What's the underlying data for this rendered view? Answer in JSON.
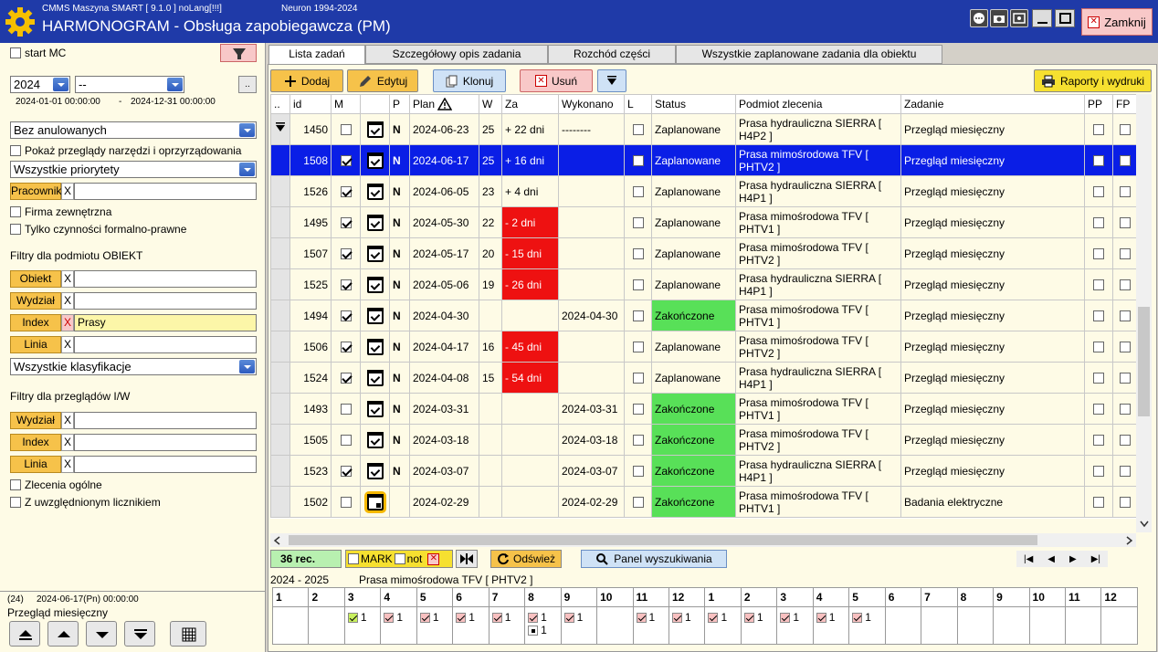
{
  "titlebar": {
    "app": "CMMS Maszyna SMART  [  9.1.0 ]  noLang[!!!]",
    "neuron": "Neuron 1994-2024",
    "title": "HARMONOGRAM - Obsługa zapobiegawcza (PM)",
    "close_label": "Zamknij"
  },
  "left": {
    "start_mc": "start MC",
    "year": "2024",
    "month": "--",
    "dots": "..",
    "date_from": "2024-01-01  00:00:00",
    "date_sep": "-",
    "date_to": "2024-12-31  00:00:00",
    "cancel_filter": "Bez anulowanych",
    "show_tools": "Pokaż przeglądy narzędzi i oprzyrządowania",
    "priority": "Wszystkie priorytety",
    "pracownik": "Pracownik",
    "firma": "Firma zewnętrzna",
    "formal": "Tylko czynności formalno-prawne",
    "obj_section": "Filtry dla podmiotu OBIEKT",
    "obiekt": "Obiekt",
    "wydzial": "Wydział",
    "index": "Index",
    "index_value": "Prasy",
    "linia": "Linia",
    "klasyfikacje": "Wszystkie klasyfikacje",
    "iw_section": "Filtry dla przeglądów I/W",
    "wydzial2": "Wydział",
    "index2": "Index",
    "linia2": "Linia",
    "zlecenia": "Zlecenia ogólne",
    "licznik": "Z uwzględnionym licznikiem",
    "x": "X",
    "status_count": "(24)",
    "status_date": "2024-06-17(Pn) 00:00:00",
    "status_task": "Przegląd miesięczny"
  },
  "tabs": [
    "Lista zadań",
    "Szczegółowy opis zadania",
    "Rozchód części",
    "Wszystkie zaplanowane zadania dla obiektu"
  ],
  "toolbar": {
    "add": "Dodaj",
    "edit": "Edytuj",
    "clone": "Klonuj",
    "delete": "Usuń",
    "reports": "Raporty i wydruki"
  },
  "grid": {
    "headers": [
      "..",
      "id",
      "M",
      "",
      "P",
      "Plan",
      "W",
      "Za",
      "Wykonano",
      "L",
      "Status",
      "Podmiot zlecenia",
      "Zadanie",
      "PP",
      "FP"
    ],
    "rows": [
      {
        "id": "1450",
        "m": false,
        "p": "N",
        "plan": "2024-06-23",
        "w": "25",
        "za": "+ 22 dni",
        "za_red": false,
        "done": "--------",
        "status": "Zaplanowane",
        "green": false,
        "subject": "Prasa hydrauliczna SIERRA [ H4P2 ]",
        "task": "Przegląd miesięczny",
        "sel": false,
        "box": false
      },
      {
        "id": "1508",
        "m": true,
        "p": "N",
        "plan": "2024-06-17",
        "w": "25",
        "za": "+ 16 dni",
        "za_red": false,
        "done": "",
        "status": "Zaplanowane",
        "green": false,
        "subject": "Prasa mimośrodowa TFV [ PHTV2 ]",
        "task": "Przegląd miesięczny",
        "sel": true,
        "box": false
      },
      {
        "id": "1526",
        "m": true,
        "p": "N",
        "plan": "2024-06-05",
        "w": "23",
        "za": "+ 4 dni",
        "za_red": false,
        "done": "",
        "status": "Zaplanowane",
        "green": false,
        "subject": "Prasa hydrauliczna SIERRA [ H4P1 ]",
        "task": "Przegląd miesięczny",
        "sel": false,
        "box": false
      },
      {
        "id": "1495",
        "m": true,
        "p": "N",
        "plan": "2024-05-30",
        "w": "22",
        "za": "- 2 dni",
        "za_red": true,
        "done": "",
        "status": "Zaplanowane",
        "green": false,
        "subject": "Prasa mimośrodowa TFV [ PHTV1 ]",
        "task": "Przegląd miesięczny",
        "sel": false,
        "box": false
      },
      {
        "id": "1507",
        "m": true,
        "p": "N",
        "plan": "2024-05-17",
        "w": "20",
        "za": "- 15 dni",
        "za_red": true,
        "done": "",
        "status": "Zaplanowane",
        "green": false,
        "subject": "Prasa mimośrodowa TFV [ PHTV2 ]",
        "task": "Przegląd miesięczny",
        "sel": false,
        "box": false
      },
      {
        "id": "1525",
        "m": true,
        "p": "N",
        "plan": "2024-05-06",
        "w": "19",
        "za": "- 26 dni",
        "za_red": true,
        "done": "",
        "status": "Zaplanowane",
        "green": false,
        "subject": "Prasa hydrauliczna SIERRA [ H4P1 ]",
        "task": "Przegląd miesięczny",
        "sel": false,
        "box": false
      },
      {
        "id": "1494",
        "m": true,
        "p": "N",
        "plan": "2024-04-30",
        "w": "",
        "za": "",
        "za_red": false,
        "done": "2024-04-30",
        "status": "Zakończone",
        "green": true,
        "subject": "Prasa mimośrodowa TFV [ PHTV1 ]",
        "task": "Przegląd miesięczny",
        "sel": false,
        "box": false
      },
      {
        "id": "1506",
        "m": true,
        "p": "N",
        "plan": "2024-04-17",
        "w": "16",
        "za": "- 45 dni",
        "za_red": true,
        "done": "",
        "status": "Zaplanowane",
        "green": false,
        "subject": "Prasa mimośrodowa TFV [ PHTV2 ]",
        "task": "Przegląd miesięczny",
        "sel": false,
        "box": false
      },
      {
        "id": "1524",
        "m": true,
        "p": "N",
        "plan": "2024-04-08",
        "w": "15",
        "za": "- 54 dni",
        "za_red": true,
        "done": "",
        "status": "Zaplanowane",
        "green": false,
        "subject": "Prasa hydrauliczna SIERRA [ H4P1 ]",
        "task": "Przegląd miesięczny",
        "sel": false,
        "box": false
      },
      {
        "id": "1493",
        "m": false,
        "p": "N",
        "plan": "2024-03-31",
        "w": "",
        "za": "",
        "za_red": false,
        "done": "2024-03-31",
        "status": "Zakończone",
        "green": true,
        "subject": "Prasa mimośrodowa TFV [ PHTV1 ]",
        "task": "Przegląd miesięczny",
        "sel": false,
        "box": false
      },
      {
        "id": "1505",
        "m": false,
        "p": "N",
        "plan": "2024-03-18",
        "w": "",
        "za": "",
        "za_red": false,
        "done": "2024-03-18",
        "status": "Zakończone",
        "green": true,
        "subject": "Prasa mimośrodowa TFV [ PHTV2 ]",
        "task": "Przegląd miesięczny",
        "sel": false,
        "box": false
      },
      {
        "id": "1523",
        "m": true,
        "p": "N",
        "plan": "2024-03-07",
        "w": "",
        "za": "",
        "za_red": false,
        "done": "2024-03-07",
        "status": "Zakończone",
        "green": true,
        "subject": "Prasa hydrauliczna SIERRA [ H4P1 ]",
        "task": "Przegląd miesięczny",
        "sel": false,
        "box": false
      },
      {
        "id": "1502",
        "m": false,
        "p": "",
        "plan": "2024-02-29",
        "w": "",
        "za": "",
        "za_red": false,
        "done": "2024-02-29",
        "status": "Zakończone",
        "green": true,
        "subject": "Prasa mimośrodowa TFV [ PHTV1 ]",
        "task": "Badania elektryczne",
        "sel": false,
        "box": true
      }
    ]
  },
  "bottom": {
    "rec": "36 rec.",
    "mark": "MARK",
    "not": "not",
    "refresh": "Odśwież",
    "search_panel": "Panel wyszukiwania"
  },
  "calendar": {
    "years": "2024 - 2025",
    "object": "Prasa mimośrodowa TFV [ PHTV2 ]",
    "months": [
      "1",
      "2",
      "3",
      "4",
      "5",
      "6",
      "7",
      "8",
      "9",
      "10",
      "11",
      "12",
      "1",
      "2",
      "3",
      "4",
      "5",
      "6",
      "7",
      "8",
      "9",
      "10",
      "11",
      "12"
    ],
    "cells": [
      "",
      "",
      "1",
      "1",
      "1",
      "1",
      "1",
      "1",
      "1",
      "",
      "1",
      "1",
      "1",
      "1",
      "1",
      "1",
      "1",
      "",
      "",
      "",
      "",
      "",
      "",
      ""
    ],
    "extra": "1"
  }
}
